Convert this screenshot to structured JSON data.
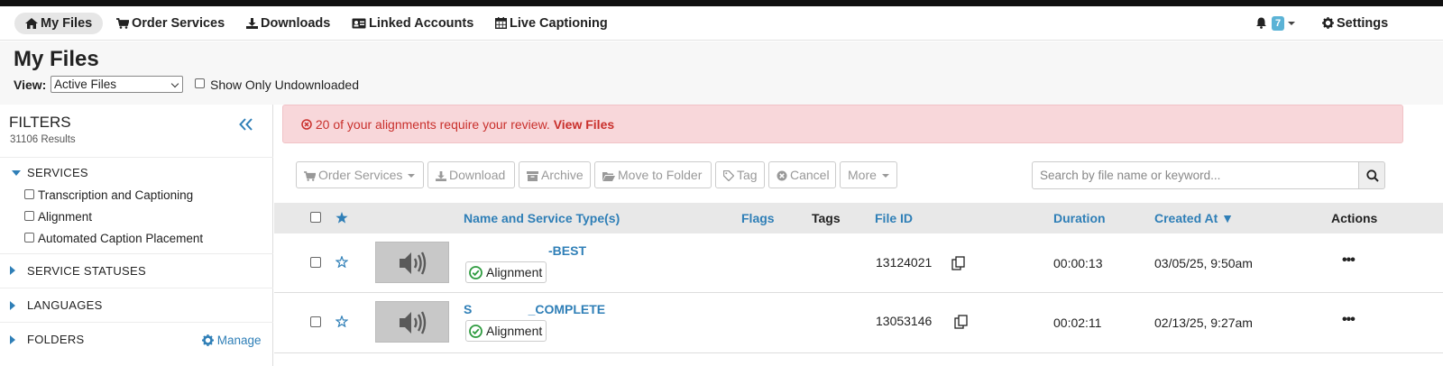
{
  "nav": {
    "my_files": "My Files",
    "order_services": "Order Services",
    "downloads": "Downloads",
    "linked_accounts": "Linked Accounts",
    "live_captioning": "Live Captioning",
    "notif_count": "7",
    "settings": "Settings"
  },
  "page": {
    "title": "My Files",
    "view_label": "View:",
    "view_value": "Active Files",
    "show_only_undownloaded": "Show Only Undownloaded"
  },
  "filters": {
    "title": "FILTERS",
    "results": "31106 Results",
    "services": {
      "label": "SERVICES",
      "options": [
        "Transcription and Captioning",
        "Alignment",
        "Automated Caption Placement"
      ]
    },
    "service_statuses": "SERVICE STATUSES",
    "languages": "LANGUAGES",
    "folders": "FOLDERS",
    "manage": "Manage"
  },
  "alert": {
    "message": "20 of your alignments require your review.",
    "link": "View Files"
  },
  "toolbar": {
    "order_services": "Order Services",
    "download": "Download",
    "archive": "Archive",
    "move_to_folder": "Move to Folder",
    "tag": "Tag",
    "cancel": "Cancel",
    "more": "More"
  },
  "search": {
    "placeholder": "Search by file name or keyword..."
  },
  "table": {
    "headers": {
      "name": "Name and Service Type(s)",
      "flags": "Flags",
      "tags": "Tags",
      "file_id": "File ID",
      "duration": "Duration",
      "created_at": "Created At ▼",
      "actions": "Actions"
    },
    "rows": [
      {
        "name": "-BEST",
        "service": "Alignment",
        "file_id": "13124021",
        "duration": "00:00:13",
        "created": "03/05/25, 9:50am"
      },
      {
        "name": "S                _COMPLETE",
        "service": "Alignment",
        "file_id": "13053146",
        "duration": "00:02:11",
        "created": "02/13/25, 9:27am"
      }
    ]
  },
  "colors": {
    "link": "#2f7fb7",
    "alert_bg": "#f8d7da",
    "alert_text": "#c9302c",
    "success": "#2e9b3f"
  }
}
